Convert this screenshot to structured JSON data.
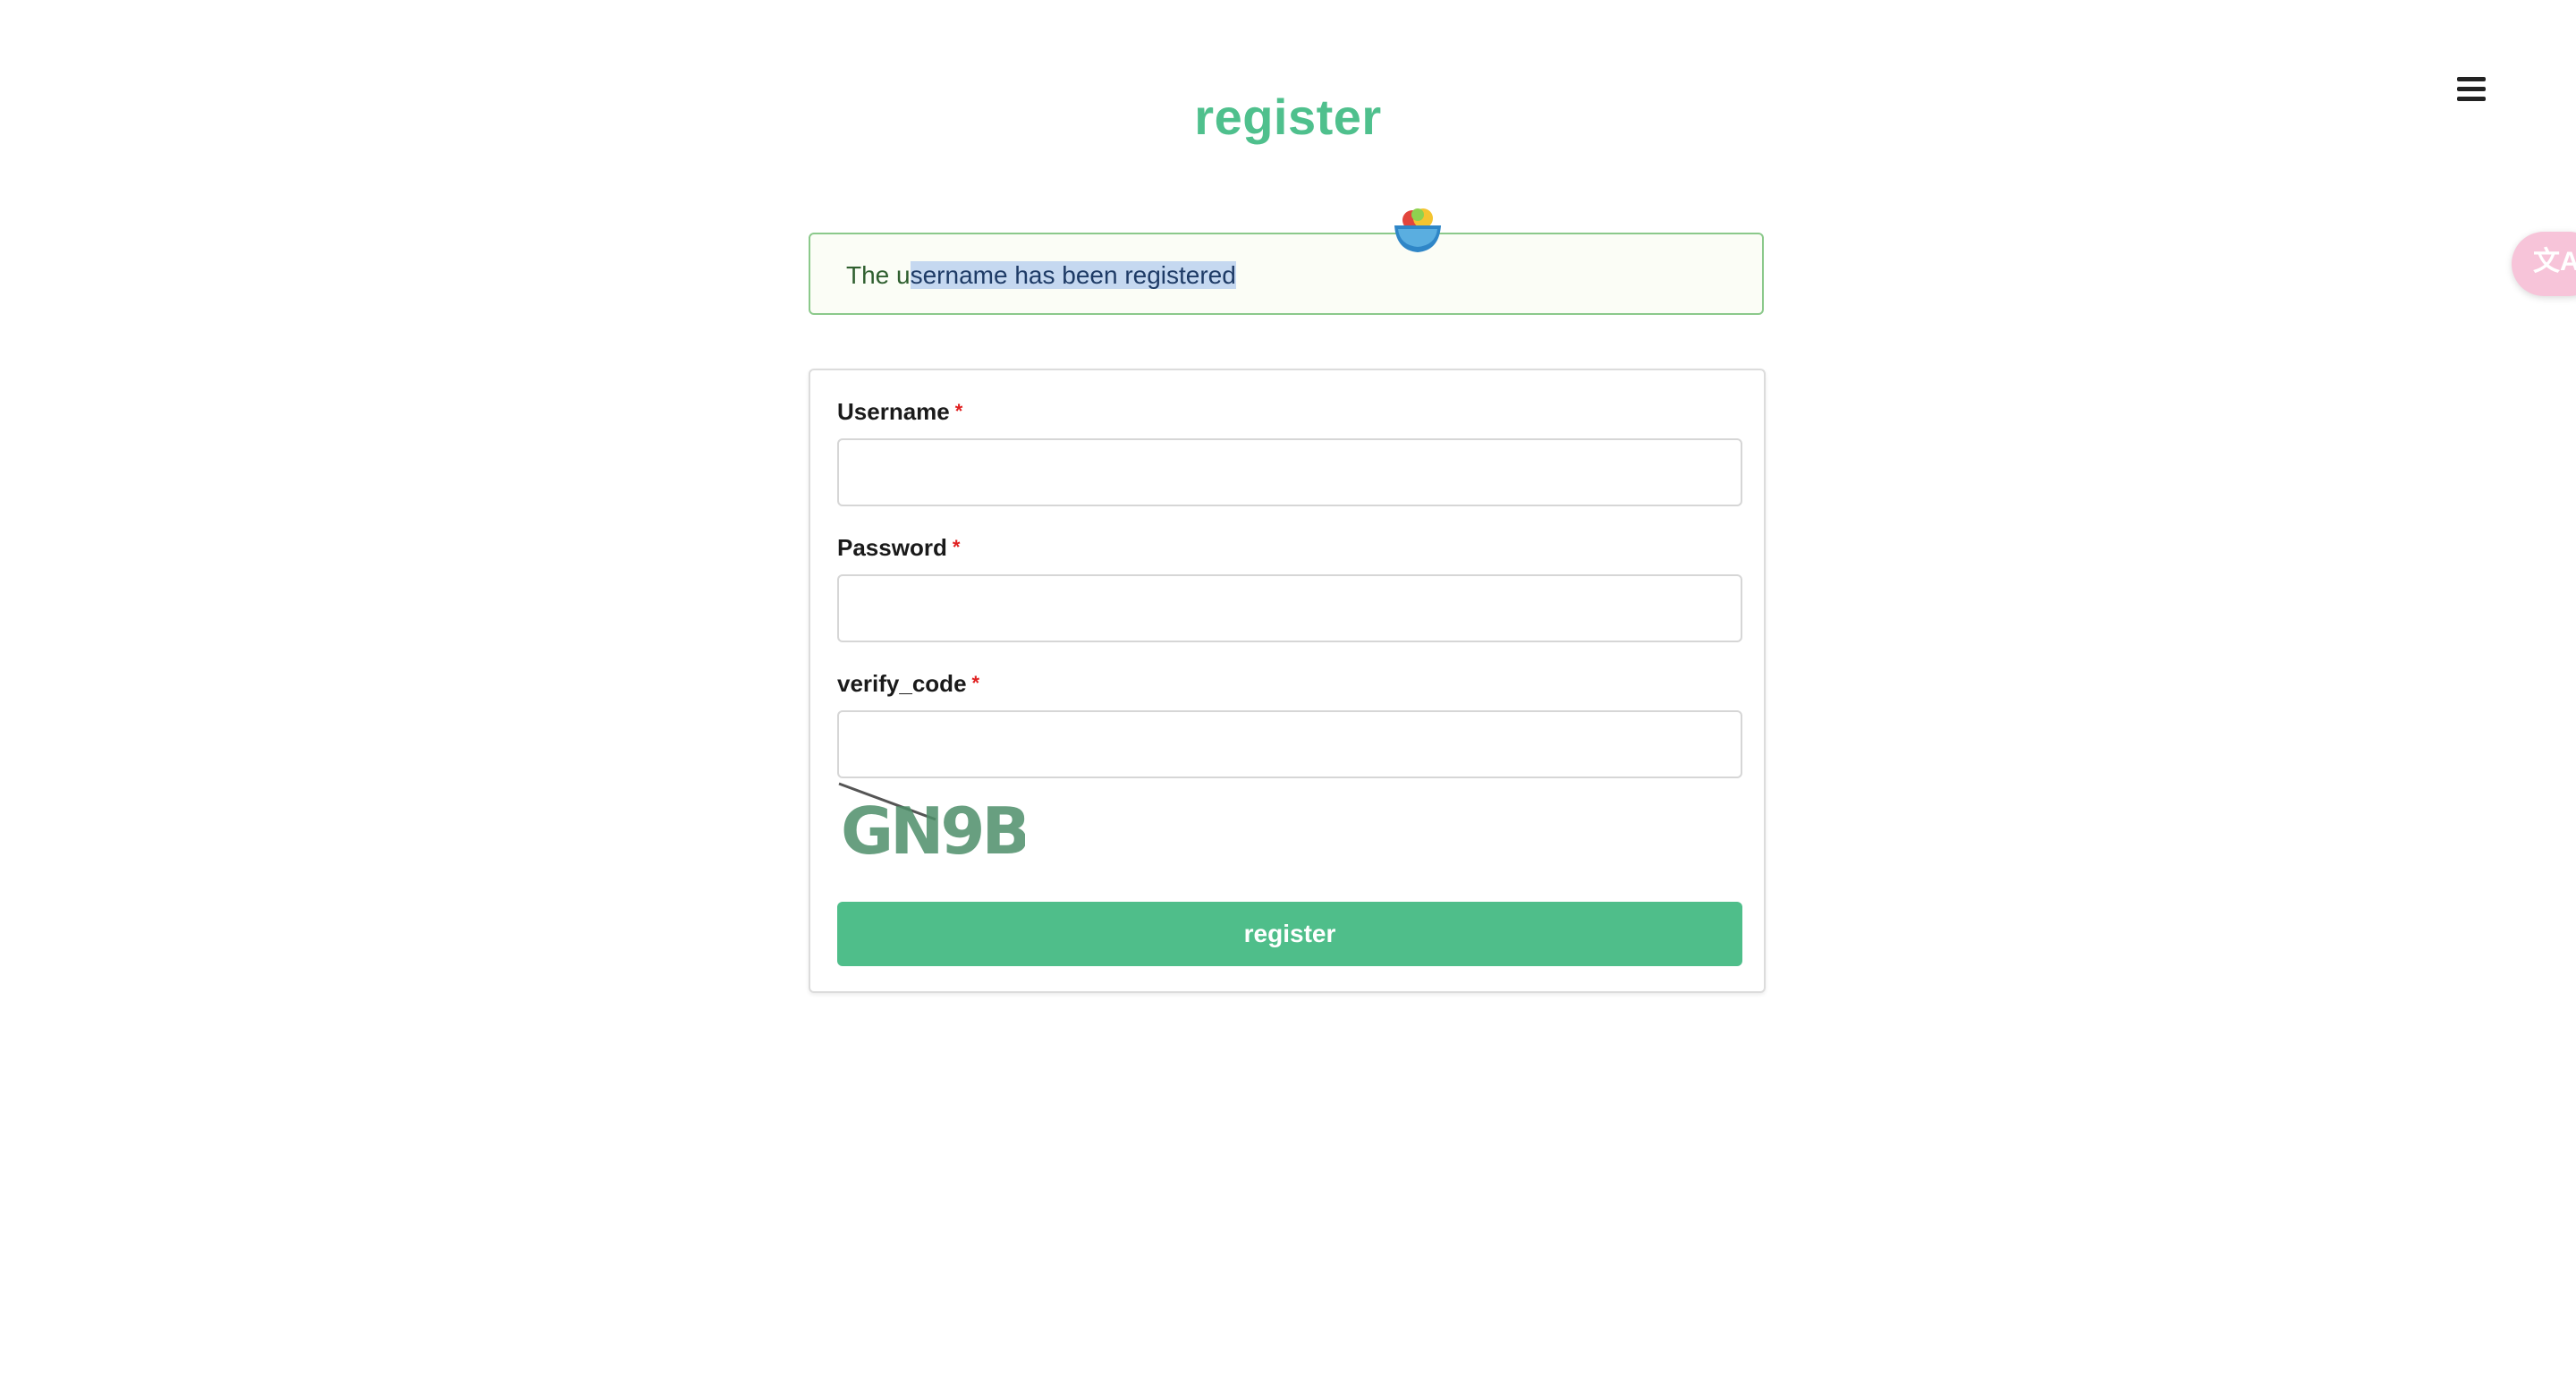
{
  "page": {
    "title": "register"
  },
  "alert": {
    "text_before": "The u",
    "text_selected": "sername has been registered"
  },
  "form": {
    "username": {
      "label": "Username",
      "required_mark": "*",
      "value": ""
    },
    "password": {
      "label": "Password",
      "required_mark": "*",
      "value": ""
    },
    "verify_code": {
      "label": "verify_code",
      "required_mark": "*",
      "value": "",
      "captcha_text": "GN9B"
    },
    "submit_label": "register"
  },
  "icons": {
    "menu": "hamburger-menu-icon",
    "translate": "translate-icon",
    "floating_badge": "fruit-bowl-icon"
  },
  "colors": {
    "accent": "#4fc08d",
    "button": "#4fbe8a",
    "alert_border": "#8bc98b",
    "alert_bg": "#fbfdf6",
    "required": "#e02020",
    "translate_widget": "#f7c4d9"
  }
}
